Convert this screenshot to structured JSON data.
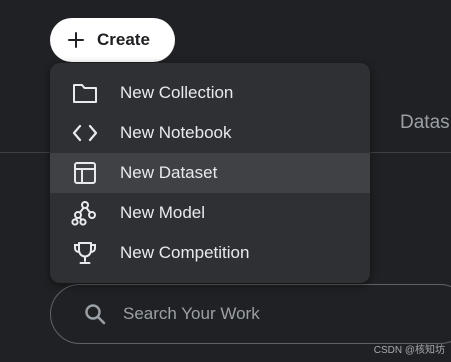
{
  "create_button": {
    "label": "Create",
    "icon": "plus-icon"
  },
  "tabs": {
    "partial_label": "Datas"
  },
  "menu": {
    "items": [
      {
        "label": "New Collection",
        "icon": "folder-icon"
      },
      {
        "label": "New Notebook",
        "icon": "code-icon"
      },
      {
        "label": "New Dataset",
        "icon": "table-icon"
      },
      {
        "label": "New Model",
        "icon": "model-icon"
      },
      {
        "label": "New Competition",
        "icon": "trophy-icon"
      }
    ],
    "highlighted_index": 2
  },
  "search": {
    "placeholder": "Search Your Work",
    "value": ""
  },
  "watermark": "CSDN @核知坊",
  "colors": {
    "background": "#202124",
    "menu_background": "#2f3033",
    "menu_highlight": "#3f4144",
    "text": "#e8eaed",
    "muted_text": "#9aa0a6"
  }
}
